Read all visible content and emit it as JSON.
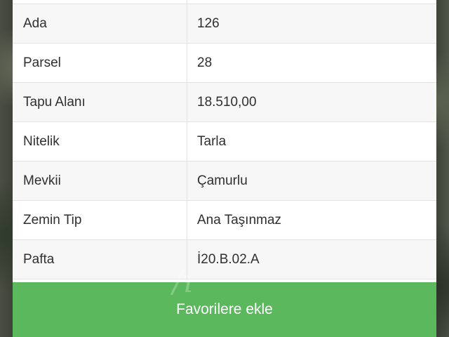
{
  "properties": [
    {
      "key": "Ada",
      "value": "126"
    },
    {
      "key": "Parsel",
      "value": "28"
    },
    {
      "key": "Tapu Alanı",
      "value": "18.510,00"
    },
    {
      "key": "Nitelik",
      "value": "Tarla"
    },
    {
      "key": "Mevkii",
      "value": "Çamurlu"
    },
    {
      "key": "Zemin Tip",
      "value": "Ana Taşınmaz"
    },
    {
      "key": "Pafta",
      "value": "İ20.B.02.A"
    }
  ],
  "actions": {
    "favorite_label": "Favorilere ekle"
  },
  "colors": {
    "accent": "#5cb85c",
    "row_alt": "#f7f7f7",
    "border": "#e3e3e3"
  }
}
